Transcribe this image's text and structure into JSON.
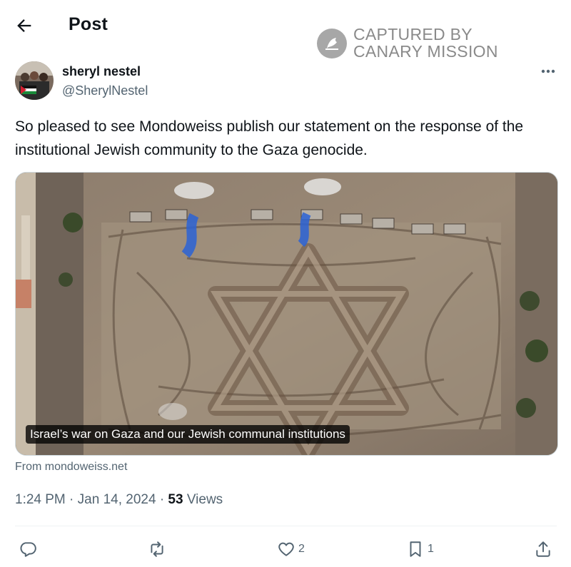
{
  "header": {
    "title": "Post",
    "back_icon": "arrow-left-icon"
  },
  "watermark": {
    "line1": "CAPTURED BY",
    "line2": "CANARY MISSION",
    "logo_icon": "canary-bird-icon"
  },
  "author": {
    "name": "sheryl nestel",
    "handle": "@SherylNestel",
    "avatar_icon": "avatar"
  },
  "more_icon": "more-dots-icon",
  "tweet": {
    "text": "So pleased to see Mondoweiss publish our statement on the response of the institutional Jewish community to the Gaza genocide."
  },
  "media_card": {
    "caption": "Israel’s war on Gaza and our Jewish communal institutions",
    "source": "From mondoweiss.net"
  },
  "meta": {
    "time": "1:24 PM",
    "date": "Jan 14, 2024",
    "views_count": "53",
    "views_label": "Views"
  },
  "actions": {
    "reply": {
      "icon": "reply-icon",
      "count": ""
    },
    "repost": {
      "icon": "repost-icon",
      "count": ""
    },
    "like": {
      "icon": "heart-icon",
      "count": "2"
    },
    "bookmark": {
      "icon": "bookmark-icon",
      "count": "1"
    },
    "share": {
      "icon": "share-icon",
      "count": ""
    }
  },
  "colors": {
    "text_primary": "#0f1419",
    "text_secondary": "#536471",
    "divider": "#eff3f4",
    "watermark": "#8a8a8a"
  }
}
